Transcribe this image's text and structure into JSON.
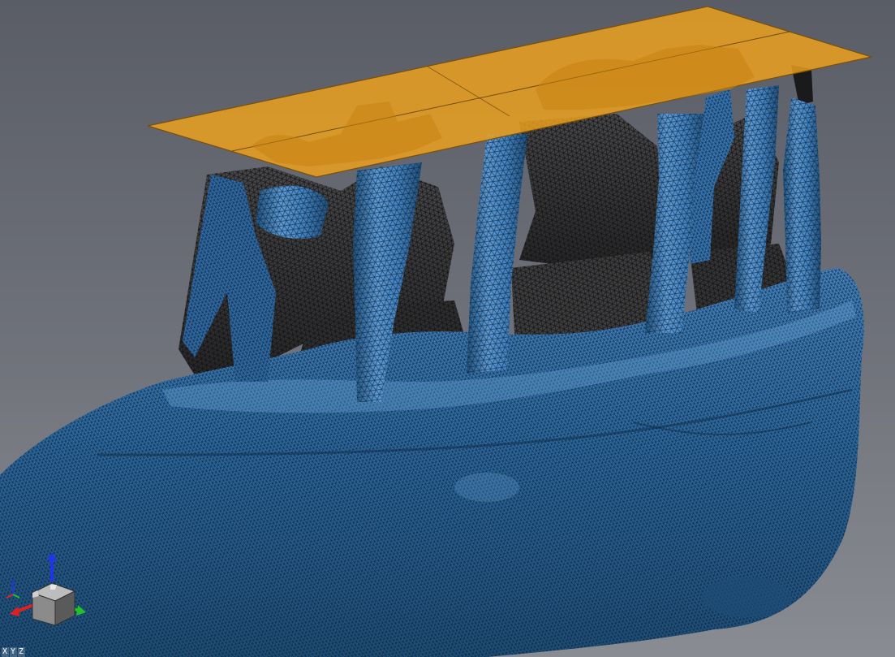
{
  "viewport": {
    "background_top": "#5a5d66",
    "background_bottom": "#8a8c93"
  },
  "model": {
    "mesh_color": "#2f6fa8",
    "mesh_highlight": "#6ea8dc",
    "mesh_line_color": "#0d1f33",
    "backface_color": "#3a3a3c"
  },
  "cutting_plane": {
    "fill_color": "#f0a21c",
    "edge_color": "#7a5008"
  },
  "orientation_widget": {
    "x_color": "#e02020",
    "y_color": "#22c02a",
    "z_color": "#1f35e8",
    "cube_color": "#8b8b8b",
    "labels": {
      "x": "X",
      "y": "Y",
      "z": "Z"
    }
  }
}
